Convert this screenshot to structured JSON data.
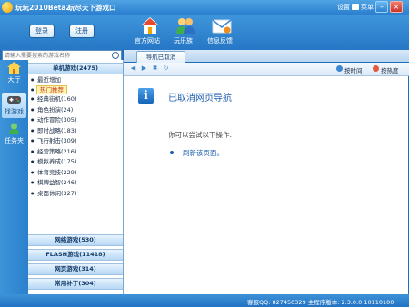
{
  "titlebar": {
    "app_name": "玩玩2010Beta2",
    "slogan": "玩尽天下游戏口",
    "settings": "设置",
    "menu": "菜单"
  },
  "header": {
    "login": "登录",
    "register": "注册",
    "nav": [
      {
        "label": "官方网站",
        "icon": "home-icon"
      },
      {
        "label": "玩乐族",
        "icon": "users-icon"
      },
      {
        "label": "信息反馈",
        "icon": "mail-icon"
      }
    ]
  },
  "search": {
    "placeholder": "请输入需要搜索的游戏名称"
  },
  "left_rail": [
    {
      "label": "大厅",
      "icon": "house-icon"
    },
    {
      "label": "找游戏",
      "icon": "gamepad-icon"
    },
    {
      "label": "任务夹",
      "icon": "task-icon"
    }
  ],
  "catalog": {
    "top_category": "单机游戏(2475)",
    "items": [
      "最近增加",
      "热门推荐",
      "经典街机(160)",
      "角色扮演(24)",
      "动作冒险(305)",
      "即时战略(183)",
      "飞行射击(309)",
      "经营策略(216)",
      "模拟养成(175)",
      "体育竞技(229)",
      "棋牌益智(246)",
      "桌面休闲(327)"
    ],
    "selected_index": 1,
    "bottom_categories": [
      "网络游戏(530)",
      "FLASH游戏(11418)",
      "网页游戏(314)",
      "常用补丁(304)"
    ]
  },
  "tab": {
    "label": "导航已取消"
  },
  "toolbar": {
    "sort_by_time": "按时间",
    "sort_by_heat": "按热度"
  },
  "content": {
    "title": "已取消网页导航",
    "subtitle": "你可以尝试以下操作:",
    "refresh_link": "刷新该页面。"
  },
  "status": {
    "text": "客服QQ: 827450329    主程序版本: 2.3.0.0 10110100"
  },
  "colors": {
    "frame": "#2a7fcf",
    "accent": "#1f5fae",
    "selected_item": "#c5340f"
  }
}
